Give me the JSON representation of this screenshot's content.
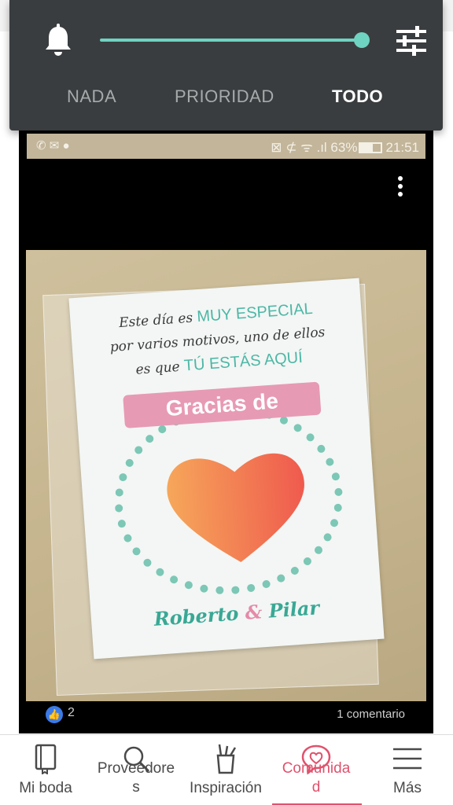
{
  "notification_shade": {
    "modes": [
      {
        "label": "NADA",
        "selected": false
      },
      {
        "label": "PRIORIDAD",
        "selected": false
      },
      {
        "label": "TODO",
        "selected": true
      }
    ],
    "volume_level": 1.0,
    "accent_color": "#6fd3c1",
    "icons": [
      "bell-icon",
      "tune-icon"
    ]
  },
  "photo": {
    "status_bar": {
      "left_icons": "✆ ✉ ●",
      "right_text": "⊠ ⊄ ᯤ .ıl 63%",
      "time": "21:51"
    },
    "card": {
      "line1_a": "Este día es",
      "line1_b": "MUY ESPECIAL",
      "line2": "por varios motivos, uno de ellos",
      "line3_a": "es que",
      "line3_b": "TÚ ESTÁS AQUÍ",
      "banner": "Gracias de",
      "name1": "Roberto",
      "amp": "&",
      "name2": "Pilar"
    },
    "likes": "2",
    "comments": "1 comentario"
  },
  "bottom_nav": {
    "items": [
      {
        "label": "Mi boda",
        "icon": "notebook-icon"
      },
      {
        "label": "Proveedore\ns",
        "icon": "search-icon"
      },
      {
        "label": "Inspiración",
        "icon": "pencil-cup-icon"
      },
      {
        "label": "Comunida\nd",
        "icon": "heart-chat-icon",
        "active": true
      },
      {
        "label": "Más",
        "icon": "menu-icon"
      }
    ],
    "active_color": "#e0526d"
  }
}
